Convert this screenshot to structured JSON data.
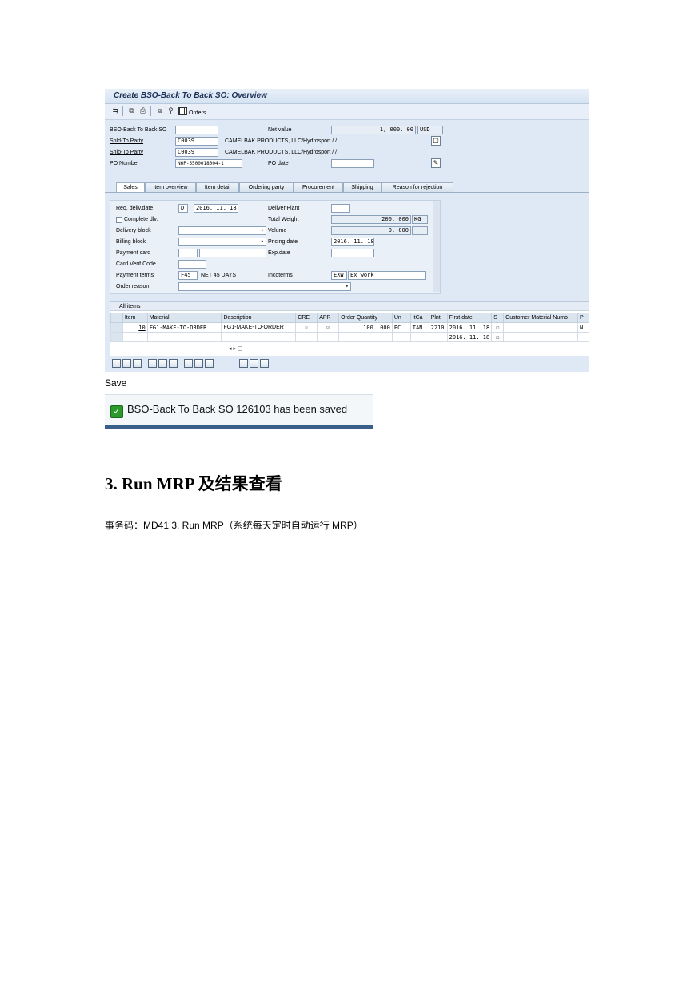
{
  "sap": {
    "title": "Create  BSO-Back To Back SO: Overview",
    "toolbar": {
      "orders_label": "Orders"
    },
    "header": {
      "bso_label": "BSO-Back To Back SO",
      "bso_value": "",
      "net_value_label": "Net value",
      "net_value": "1, 000. 00",
      "currency": "USD",
      "sold_to_label": "Sold-To Party",
      "sold_to_value": "C0039",
      "sold_to_name": "CAMELBAK PRODUCTS, LLC/Hydrosport / /",
      "ship_to_label": "Ship-To Party",
      "ship_to_value": "C0039",
      "ship_to_name": "CAMELBAK PRODUCTS, LLC/Hydrosport / /",
      "po_number_label": "PO Number",
      "po_number_value": "N6P-5500018004-1",
      "po_date_label": "PO date",
      "po_date_value": ""
    },
    "tabs": [
      "Sales",
      "Item overview",
      "Item detail",
      "Ordering party",
      "Procurement",
      "Shipping",
      "Reason for rejection"
    ],
    "sales": {
      "req_deliv_date_label": "Req. deliv.date",
      "req_deliv_date_type": "D",
      "req_deliv_date_value": "2016. 11. 18",
      "complete_dlv_label": "Complete dlv.",
      "delivery_block_label": "Delivery block",
      "billing_block_label": "Billing block",
      "payment_card_label": "Payment card",
      "card_verif_label": "Card Verif.Code",
      "payment_terms_label": "Payment terms",
      "payment_terms_code": "F45",
      "payment_terms_text": "NET 45 DAYS",
      "order_reason_label": "Order reason",
      "deliver_plant_label": "Deliver.Plant",
      "total_weight_label": "Total Weight",
      "total_weight_value": "200. 000",
      "weight_unit": "KG",
      "volume_label": "Volume",
      "volume_value": "0. 000",
      "pricing_date_label": "Pricing date",
      "pricing_date_value": "2016. 11. 18",
      "exp_date_label": "Exp.date",
      "incoterms_label": "Incoterms",
      "incoterms_code": "EXW",
      "incoterms_text": "Ex work"
    },
    "items": {
      "title": "All items",
      "columns": [
        "Item",
        "Material",
        "Description",
        "CRE",
        "APR",
        "Order Quantity",
        "Un",
        "ItCa",
        "Plnt",
        "First date",
        "S",
        "Customer Material Numb",
        "P"
      ],
      "rows": [
        {
          "item": "10",
          "material": "FG1-MAKE-TO-ORDER",
          "description": "FG1-MAKE-TO-ORDER",
          "quantity": "100. 000",
          "unit": "PC",
          "itca": "TAN",
          "plant": "2210",
          "first_date": "2016. 11. 18",
          "p": "N"
        },
        {
          "item": "",
          "material": "",
          "description": "",
          "quantity": "",
          "unit": "",
          "itca": "",
          "plant": "",
          "first_date": "2016. 11. 18",
          "p": ""
        }
      ]
    }
  },
  "doc": {
    "save_label": "Save",
    "status_message": "BSO-Back To Back SO 126103 has been saved",
    "heading": "3.  Run MRP 及结果查看",
    "paragraph": "事务码：MD41 3.  Run MRP（系统每天定时自动运行 MRP）"
  }
}
